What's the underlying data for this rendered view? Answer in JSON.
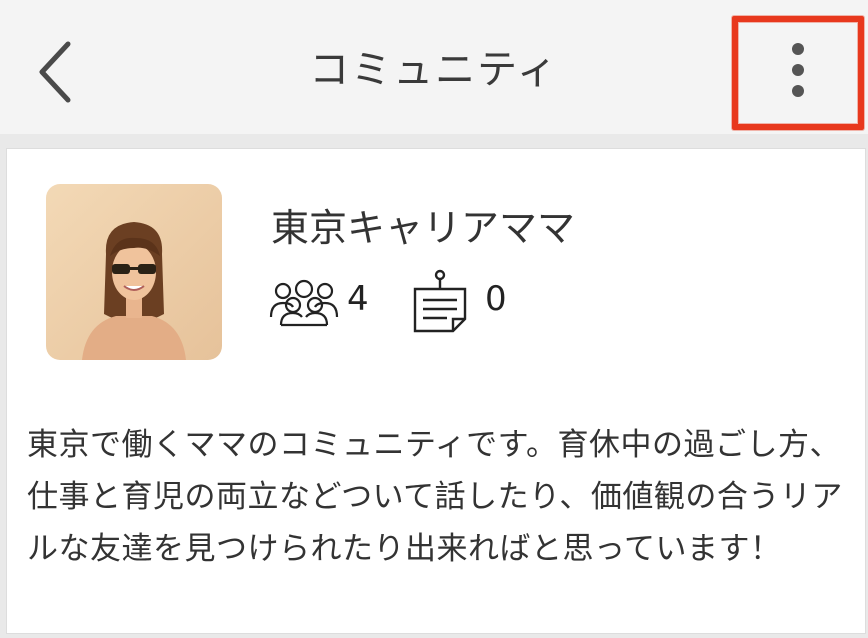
{
  "header": {
    "title": "コミュニティ",
    "back_icon": "chevron-left-icon",
    "menu_icon": "more-vertical-icon",
    "highlight_color": "#e8381d"
  },
  "community": {
    "name": "東京キャリアママ",
    "members_count": "4",
    "posts_count": "0",
    "members_icon": "group-icon",
    "posts_icon": "bulletin-note-icon",
    "description": "東京で働くママのコミュニティです。育休中の過ごし方、仕事と育児の両立などついて話したり、価値観の合うリアルな友達を見つけられたり出来ればと思っています！"
  }
}
